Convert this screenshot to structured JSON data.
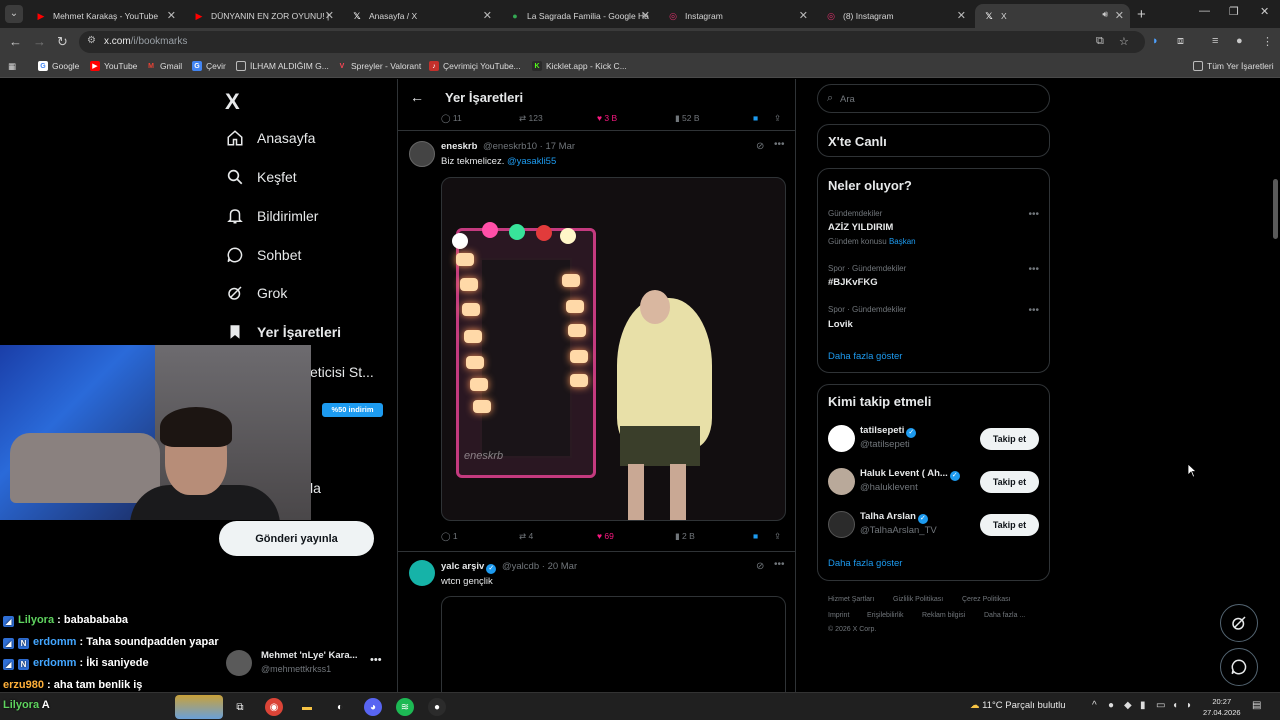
{
  "browser": {
    "tabs": [
      {
        "title": "Mehmet Karakaş - YouTube",
        "icon": "youtube-icon",
        "icon_color": "#ff0000"
      },
      {
        "title": "DÜNYANIN EN ZOR OYUNU! |",
        "icon": "youtube-icon",
        "icon_color": "#ff0000"
      },
      {
        "title": "Anasayfa / X",
        "icon": "x-icon",
        "icon_color": "#ffffff"
      },
      {
        "title": "La Sagrada Familia - Google Ha",
        "icon": "maps-pin-icon",
        "icon_color": "#34a853"
      },
      {
        "title": "Instagram",
        "icon": "instagram-icon",
        "icon_color": "#e1306c"
      },
      {
        "title": "(8) Instagram",
        "icon": "instagram-icon",
        "icon_color": "#e1306c"
      },
      {
        "title": "X",
        "icon": "x-icon",
        "icon_color": "#ffffff",
        "active": true
      }
    ],
    "url_host": "x.com",
    "url_path": "/i/bookmarks",
    "bookmarks": [
      {
        "label": "Google",
        "icon": "google-icon",
        "color": "#4285f4"
      },
      {
        "label": "YouTube",
        "icon": "youtube-icon",
        "color": "#ff0000"
      },
      {
        "label": "Gmail",
        "icon": "gmail-icon",
        "color": "#ea4335"
      },
      {
        "label": "Çevir",
        "icon": "translate-icon",
        "color": "#4285f4"
      },
      {
        "label": "İLHAM ALDIĞIM G...",
        "icon": "folder-icon",
        "color": "#bbbbbb"
      },
      {
        "label": "Spreyler - Valorant",
        "icon": "valorant-icon",
        "color": "#ff4655"
      },
      {
        "label": "Çevrimiçi YouTube...",
        "icon": "converter-icon",
        "color": "#ff0000"
      },
      {
        "label": "Kicklet.app - Kick C...",
        "icon": "kicklet-icon",
        "color": "#53fc18"
      }
    ],
    "all_bookmarks": "Tüm Yer İşaretleri"
  },
  "sidebar": {
    "logo": "X",
    "items": [
      {
        "label": "Anasayfa",
        "icon": "home-icon"
      },
      {
        "label": "Keşfet",
        "icon": "search-icon"
      },
      {
        "label": "Bildirimler",
        "icon": "bell-icon"
      },
      {
        "label": "Sohbet",
        "icon": "chat-bubble-icon"
      },
      {
        "label": "Grok",
        "icon": "grok-icon"
      },
      {
        "label": "Yer İşaretleri",
        "icon": "bookmark-icon",
        "active": true
      }
    ],
    "partial_label_1": "eticisi St...",
    "premium_badge": "%50 indirim",
    "partial_label_2": "la",
    "post_button": "Gönderi yayınla",
    "account": {
      "name": "Mehmet 'nLye' Kara...",
      "handle": "@mehmettkrkss1"
    }
  },
  "stream_chat": [
    {
      "user": "Lilyora",
      "message": "bababababa",
      "color": "u-green",
      "badge": false
    },
    {
      "user": "erdomm",
      "message": "Taha soundpadden yapar",
      "color": "u-blue",
      "badge": true
    },
    {
      "user": "erdomm",
      "message": "İki saniyede",
      "color": "u-blue",
      "badge": true
    },
    {
      "user": "erzu980",
      "message": "aha tam benlik iş",
      "color": "u-orange",
      "badge": false
    },
    {
      "user": "Lilyora",
      "message": "A",
      "color": "u-green",
      "badge": false
    }
  ],
  "timeline": {
    "title": "Yer İşaretleri",
    "prev_tweet_stats": {
      "replies": "11",
      "reposts": "123",
      "likes": "3 B",
      "views": "52 B"
    },
    "tweets": [
      {
        "author": "eneskrb",
        "handle": "@eneskrb10",
        "date": "17 Mar",
        "text": "Biz tekmelicez.",
        "mention": "@yasakli55",
        "watermark": "eneskrb",
        "stats": {
          "replies": "1",
          "reposts": "4",
          "likes": "69",
          "views": "2 B"
        }
      },
      {
        "author": "yalc arşiv",
        "handle": "@yalcdb",
        "date": "20 Mar",
        "text": "wtcn gençlik",
        "verified": true
      }
    ]
  },
  "right": {
    "search_placeholder": "Ara",
    "live_title": "X'te Canlı",
    "trends_title": "Neler oluyor?",
    "trends": [
      {
        "category": "Gündemdekiler",
        "name": "AZİZ YILDIRIM",
        "sub": "Gündem konusu",
        "sub_link": "Başkan"
      },
      {
        "category": "Spor · Gündemdekiler",
        "name": "#BJKvFKG"
      },
      {
        "category": "Spor · Gündemdekiler",
        "name": "Lovik"
      }
    ],
    "trends_more": "Daha fazla göster",
    "wtf_title": "Kimi takip etmeli",
    "who_to_follow": [
      {
        "name": "tatilsepeti",
        "handle": "@tatilsepeti",
        "button": "Takip et",
        "avatar_color": "#ffffff"
      },
      {
        "name": "Haluk Levent ( Ah...",
        "handle": "@haluklevent",
        "button": "Takip et",
        "avatar_color": "#b9a99a"
      },
      {
        "name": "Talha Arslan",
        "handle": "@TalhaArslan_TV",
        "button": "Takip et",
        "avatar_color": "#2b2b2b"
      }
    ],
    "wtf_more": "Daha fazla göster",
    "footer": [
      "Hizmet Şartları",
      "Gizlilik Politikası",
      "Çerez Politikası",
      "Imprint",
      "Erişilebilirlik",
      "Reklam bilgisi",
      "Daha fazla ...",
      "© 2026 X Corp."
    ]
  },
  "taskbar": {
    "weather": "11°C  Parçalı bulutlu",
    "time": "20:27",
    "date": "27.04.2026"
  }
}
